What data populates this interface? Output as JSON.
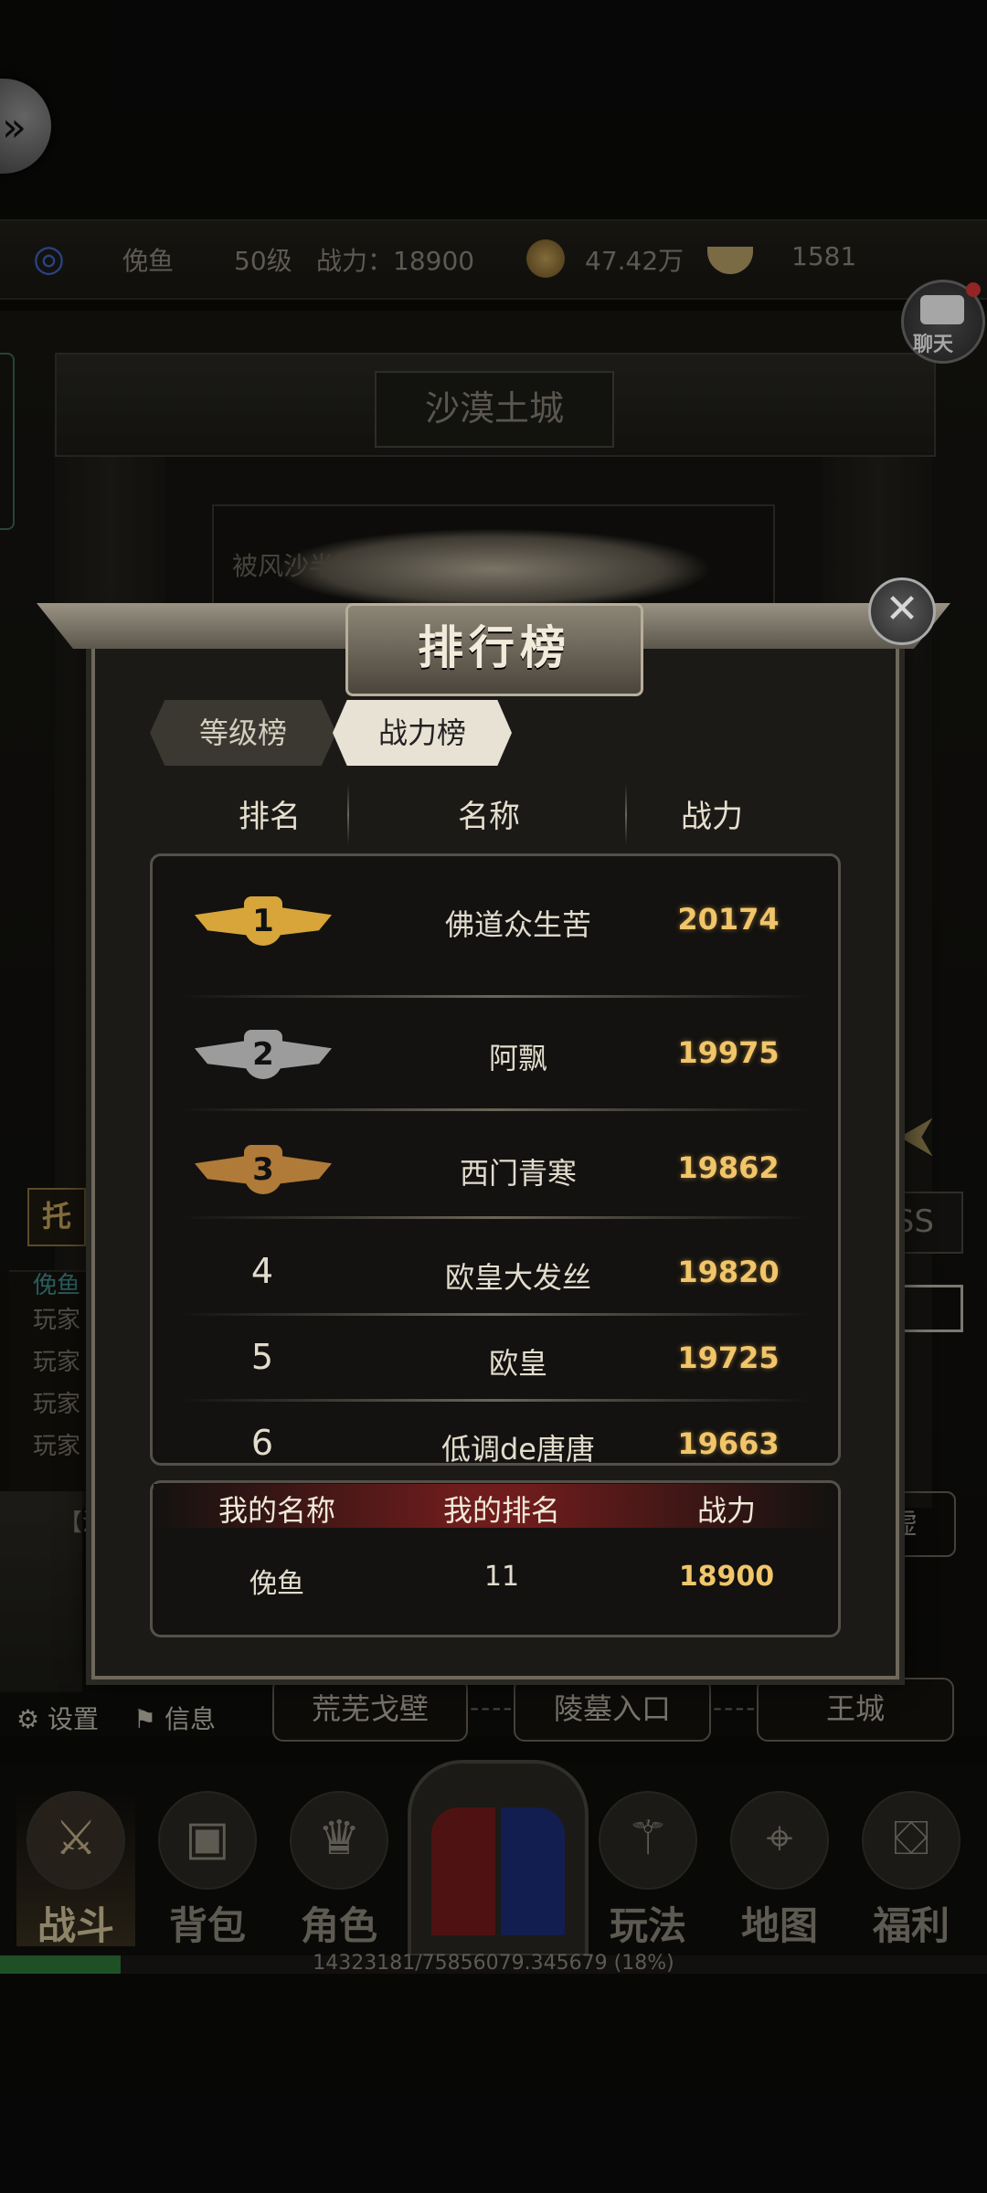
{
  "player": {
    "name": "俛鱼",
    "level": "50级",
    "power_label": "战力：18900",
    "copper": "47.42万",
    "gold": "1581"
  },
  "chat_button": {
    "label": "聊天"
  },
  "scene": {
    "city_name": "沙漠土城",
    "description": "被风沙半掩的…于此，也是交通要道…",
    "tuo_label": "托",
    "boss_label": "OSS",
    "xu_label": "虚",
    "map_label": "【沙",
    "chat_log": {
      "first": "俛鱼",
      "lines": [
        "玩家",
        "玩家",
        "玩家",
        "玩家"
      ]
    },
    "settings_label": "设置",
    "info_label": "信息",
    "locations": [
      "荒芜戈壁",
      "陵墓入口",
      "王城"
    ],
    "loc_sep": "----"
  },
  "nav": {
    "items": [
      "战斗",
      "背包",
      "角色",
      "玩法",
      "地图",
      "福利"
    ],
    "active": "战斗"
  },
  "exp": {
    "text": "14323181/75856079.345679 (18%)",
    "fraction": 0.18
  },
  "ranking": {
    "title": "排行榜",
    "tabs": [
      "等级榜",
      "战力榜"
    ],
    "active_tab": "战力榜",
    "columns": [
      "排名",
      "名称",
      "战力"
    ],
    "rows": [
      {
        "rank": "1",
        "name": "佛道众生苦",
        "power": "20174"
      },
      {
        "rank": "2",
        "name": "阿飘",
        "power": "19975"
      },
      {
        "rank": "3",
        "name": "西门青寒",
        "power": "19862"
      },
      {
        "rank": "4",
        "name": "欧皇大发丝",
        "power": "19820"
      },
      {
        "rank": "5",
        "name": "欧皇",
        "power": "19725"
      },
      {
        "rank": "6",
        "name": "低调de唐唐",
        "power": "19663"
      }
    ],
    "mine": {
      "headers": [
        "我的名称",
        "我的排名",
        "战力"
      ],
      "name": "俛鱼",
      "rank": "11",
      "power": "18900"
    },
    "close_symbol": "✕"
  },
  "colors": {
    "accent_gold": "#f1c56a",
    "panel": "#1b1a17",
    "exp_green": "#2f7a3a"
  }
}
